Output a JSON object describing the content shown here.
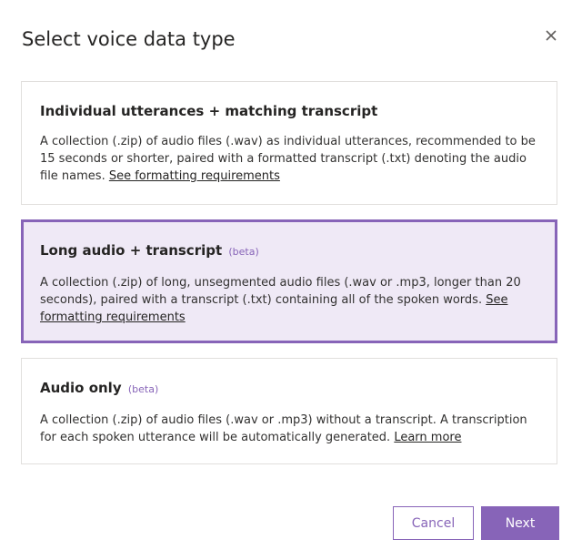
{
  "dialog": {
    "title": "Select voice data type",
    "close_icon": "close-icon"
  },
  "options": [
    {
      "title": "Individual utterances + matching transcript",
      "badge": "",
      "description": "A collection (.zip) of audio files (.wav) as individual utterances, recommended to be 15 seconds or shorter, paired with a formatted transcript (.txt) denoting the audio file names. ",
      "link": "See formatting requirements",
      "selected": false
    },
    {
      "title": "Long audio + transcript",
      "badge": "(beta)",
      "description": "A collection (.zip) of long, unsegmented audio files (.wav or .mp3, longer than 20 seconds), paired with a transcript (.txt) containing all of the spoken words. ",
      "link": "See formatting requirements",
      "selected": true
    },
    {
      "title": "Audio only",
      "badge": "(beta)",
      "description": "A collection (.zip) of audio files (.wav or .mp3) without a transcript. A transcription for each spoken utterance will be automatically generated. ",
      "link": "Learn more",
      "selected": false
    }
  ],
  "footer": {
    "cancel_label": "Cancel",
    "next_label": "Next"
  },
  "colors": {
    "accent": "#8764b8",
    "selected_background": "#efe9f6",
    "border": "#e1dfdd",
    "text": "#252423"
  }
}
